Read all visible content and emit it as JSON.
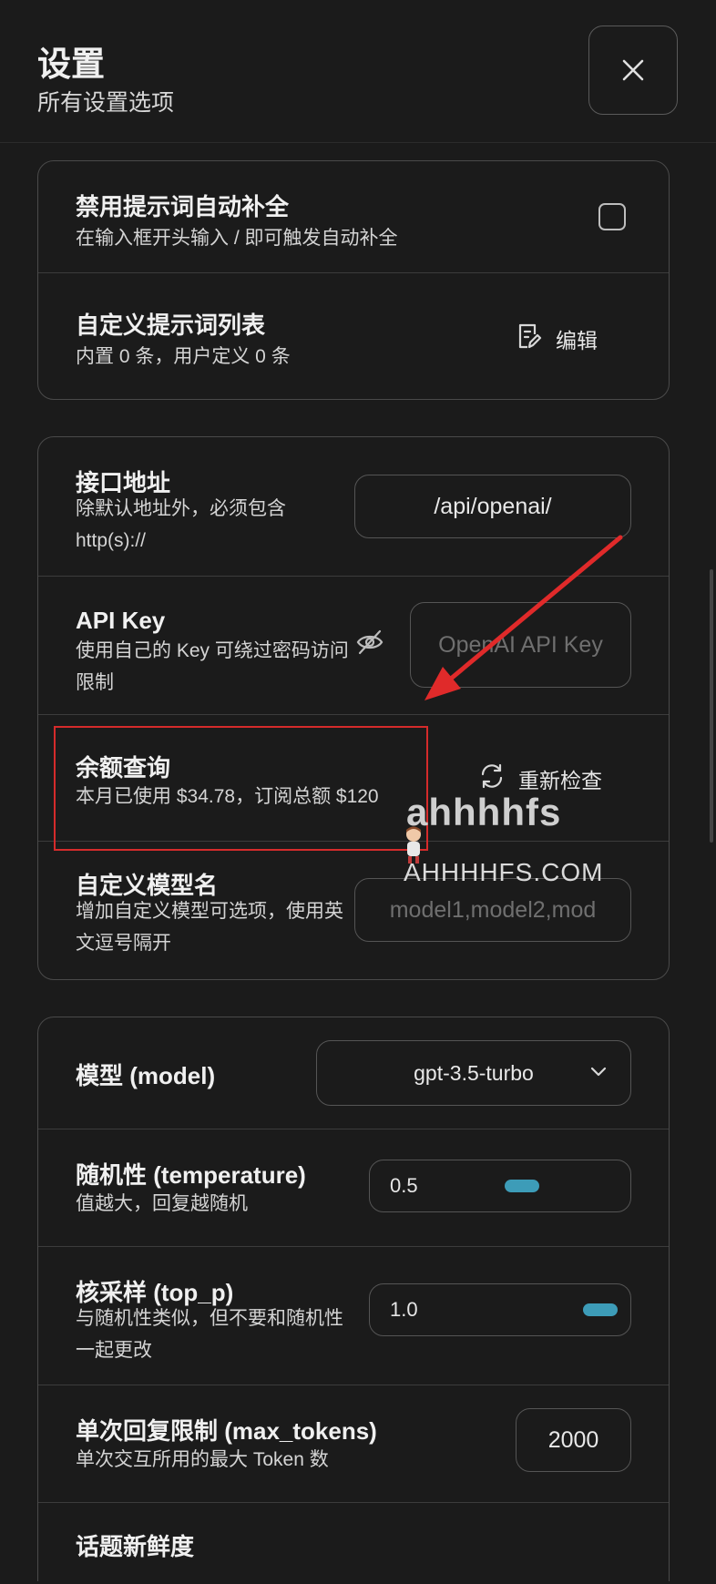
{
  "header": {
    "title": "设置",
    "subtitle": "所有设置选项"
  },
  "section1": {
    "disable_autocomplete": {
      "title": "禁用提示词自动补全",
      "subtitle": "在输入框开头输入 / 即可触发自动补全",
      "checked": false
    },
    "custom_prompts": {
      "title": "自定义提示词列表",
      "subtitle": "内置 0 条，用户定义 0 条",
      "edit_label": "编辑"
    }
  },
  "section2": {
    "endpoint": {
      "title": "接口地址",
      "subtitle": "除默认地址外，必须包含 http(s)://",
      "value": "/api/openai/"
    },
    "api_key": {
      "title": "API Key",
      "subtitle": "使用自己的 Key 可绕过密码访问限制",
      "placeholder": "OpenAI API Key"
    },
    "balance": {
      "title": "余额查询",
      "subtitle": "本月已使用 $34.78，订阅总额 $120",
      "recheck_label": "重新检查"
    },
    "custom_models": {
      "title": "自定义模型名",
      "subtitle": "增加自定义模型可选项，使用英文逗号隔开",
      "placeholder": "model1,model2,mod"
    }
  },
  "section3": {
    "model": {
      "title": "模型 (model)",
      "selected": "gpt-3.5-turbo"
    },
    "temperature": {
      "title": "随机性 (temperature)",
      "subtitle": "值越大，回复越随机",
      "value": "0.5",
      "fraction": 0.5
    },
    "top_p": {
      "title": "核采样 (top_p)",
      "subtitle": "与随机性类似，但不要和随机性一起更改",
      "value": "1.0",
      "fraction": 1.0
    },
    "max_tokens": {
      "title": "单次回复限制 (max_tokens)",
      "subtitle": "单次交互所用的最大 Token 数",
      "value": "2000"
    },
    "presence_penalty": {
      "title": "话题新鲜度"
    }
  },
  "watermark": {
    "text": "ahhhhfs",
    "domain": "AHHHHFS.COM"
  },
  "colors": {
    "background": "#1b1b1b",
    "accent": "#3d9cb8",
    "highlight": "#d52b2b"
  }
}
